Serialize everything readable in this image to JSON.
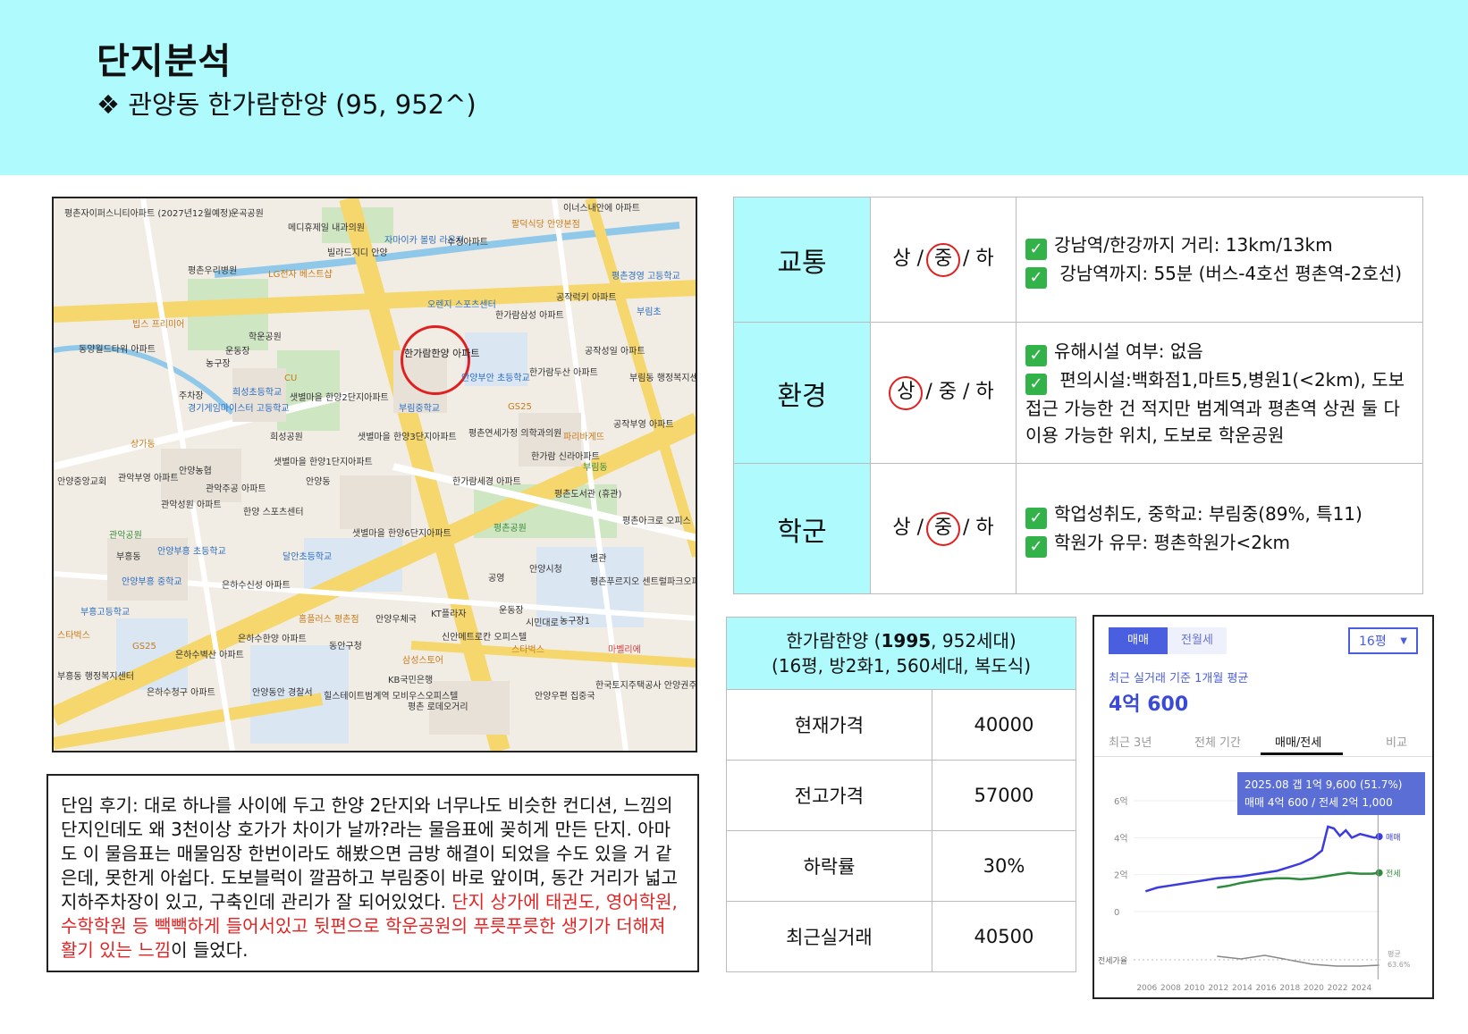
{
  "header": {
    "title": "단지분석",
    "subtitle": "❖ 관양동 한가람한양 (95, 952^)"
  },
  "map": {
    "labels": [
      "평촌자이퍼스니티아파트 (2027년12월예정)",
      "운곡공원",
      "메디휴제일 내과의원",
      "자마이카 볼링 라운지",
      "빌라드지디 안양",
      "수정아파트",
      "이너스내안에 아파트",
      "팔덕식당 안양본점",
      "평촌우리병원",
      "LG전자 베스트샵",
      "평촌경영 고등학교",
      "공작럭키 아파트",
      "오렌지 스포츠센터",
      "한가람삼성 아파트",
      "부림초",
      "빕스 프리미어",
      "학운공원",
      "동양월드타워 아파트",
      "운동장",
      "한가람한양 아파트",
      "공작성일 아파트",
      "농구장",
      "안양부안 초등학교",
      "한가람두산 아파트",
      "부림동 행정복지센터",
      "희성초등학교",
      "샛별마을 한양2단지아파트",
      "CU",
      "주차장",
      "경기게임마이스터 고등학교",
      "부림중학교",
      "GS25",
      "평촌연세가정 의학과의원",
      "공작부영 아파트",
      "희성공원",
      "샛별마을 한양3단지아파트",
      "파리바게뜨",
      "상가동",
      "안양농협",
      "샛별마을 한양1단지아파트",
      "한가람 신라아파트",
      "부림동",
      "안양중앙교회",
      "관악부영 아파트",
      "관악주공 아파트",
      "안양동",
      "한가람세경 아파트",
      "평촌도서관 (휴관)",
      "관악성원 아파트",
      "한양 스포츠센터",
      "샛별마을 한양6단지아파트",
      "평촌공원",
      "평촌아크로 오피스",
      "관악공원",
      "부흥동",
      "안양부흥 초등학교",
      "달안초등학교",
      "안양시청",
      "별관",
      "공영",
      "안양부흥 중학교",
      "은하수신성 아파트",
      "평촌푸르지오 센트럴파크오피스텔",
      "부흥고등학교",
      "홈플러스 평촌점",
      "KT플라자",
      "운동장",
      "시민대로",
      "농구장1",
      "스타벅스",
      "은하수한양 아파트",
      "안양우체국",
      "신안메트로칸 오피스텔",
      "마벨리에",
      "은하수벽산 아파트",
      "동안구청",
      "스타벅스",
      "삼성스토어",
      "부흥동 행정복지센터",
      "은하수청구 아파트",
      "안양동안 경찰서",
      "KB국민은행",
      "힐스테이트범계역 모비우스오피스텔",
      "평촌 로데오거리",
      "안양우편 집중국",
      "한국토지주택공사 안양권주거복지지사",
      "GS25"
    ]
  },
  "analysis": {
    "rows": [
      {
        "category": "교통",
        "grade_parts": [
          "상 / ",
          "중",
          " / 하"
        ],
        "circled": "중",
        "items": [
          "강남역/한강까지 거리: 13km/13km",
          " 강남역까지:  55분 (버스-4호선  평촌역-2호선)"
        ]
      },
      {
        "category": "환경",
        "grade_parts": [
          "",
          "상",
          " / 중 / 하"
        ],
        "circled": "상",
        "items": [
          "유해시설 여부: 없음",
          "  편의시설:백화점1,마트5,병원1(<2km),  도보 접근 가능한 건 적지만 범계역과 평촌역 상권 둘 다 이용 가능한 위치, 도보로 학운공원"
        ]
      },
      {
        "category": "학군",
        "grade_parts": [
          "상 / ",
          "중",
          " / 하"
        ],
        "circled": "중",
        "items": [
          "학업성취도, 중학교: 부림중(89%, 특11)",
          "학원가 유무: 평촌학원가<2km"
        ]
      }
    ],
    "check_icon": "✓"
  },
  "review": {
    "plain": "단임 후기: 대로 하나를 사이에 두고 한양 2단지와 너무나도 비슷한 컨디션, 느낌의 단지인데도 왜 3천이상 호가가 차이가 날까?라는 물음표에 꽂히게 만든 단지. 아마도 이 물음표는 매물임장 한번이라도 해봤으면 금방 해결이 되었을 수도 있을 거 같은데, 못한게 아쉽다. 도보블럭이 깔끔하고 부림중이 바로 앞이며, 동간 거리가 넓고 지하주차장이 있고, 구축인데 관리가 잘 되어있었다. ",
    "highlight": "단지 상가에 태권도, 영어학원, 수학학원 등 빽빽하게 들어서있고 뒷편으로 학운공원의 푸릇푸릇한 생기가 더해져 활기 있는 느낌",
    "tail": "이 들었다."
  },
  "price_table": {
    "header_line1_pre": "한가람한양 (",
    "header_line1_bold": "1995",
    "header_line1_post": ", 952세대)",
    "header_line2": "(16평, 방2화1, 560세대, 복도식)",
    "rows": [
      {
        "label": "현재가격",
        "value": "40000"
      },
      {
        "label": "전고가격",
        "value": "57000"
      },
      {
        "label": "하락률",
        "value": "30%"
      },
      {
        "label": "최근실거래",
        "value": "40500"
      }
    ]
  },
  "chart_panel": {
    "tab_sale": "매매",
    "tab_rent": "전월세",
    "size_select": "16평",
    "note": "최근 실거래 기준 1개월 평균",
    "price": "4억 600",
    "period_tabs": [
      "최근 3년",
      "전체 기간",
      "매매/전세",
      "비교"
    ],
    "active_tab": "매매/전세",
    "tooltip_line1": "2025.08  갭 1억 9,600 (51.7%)",
    "tooltip_line2": "매매 4억 600 / 전세 2억 1,000",
    "colors": {
      "sale": "#3b3be0",
      "rent": "#2e8b3e",
      "ratio": "#888888",
      "accent": "#4a5ee0"
    }
  },
  "chart_data": {
    "type": "line",
    "y_tick_labels": [
      "6억",
      "4억",
      "2억",
      "0"
    ],
    "ylim": [
      0,
      6
    ],
    "xlim": [
      2005,
      2025.7
    ],
    "x_tick_labels": [
      "2006",
      "2008",
      "2010",
      "2012",
      "2014",
      "2016",
      "2018",
      "2020",
      "2022",
      "2024"
    ],
    "series": [
      {
        "name": "매매",
        "x": [
          2006,
          2007,
          2008,
          2009,
          2010,
          2011,
          2012,
          2013,
          2014,
          2015,
          2016,
          2017,
          2018,
          2019,
          2020,
          2020.8,
          2021.3,
          2021.8,
          2022.3,
          2022.8,
          2023.3,
          2024,
          2024.6,
          2025.2,
          2025.6
        ],
        "values": [
          1.1,
          1.3,
          1.4,
          1.5,
          1.6,
          1.7,
          1.8,
          1.85,
          1.9,
          2.0,
          2.1,
          2.2,
          2.4,
          2.6,
          2.9,
          3.3,
          4.6,
          4.5,
          4.1,
          4.4,
          4.0,
          4.2,
          4.1,
          4.0,
          4.06
        ]
      },
      {
        "name": "전세",
        "x": [
          2012,
          2013,
          2014,
          2015,
          2016,
          2017,
          2018,
          2019,
          2020,
          2021,
          2022,
          2023,
          2024,
          2025,
          2025.6
        ],
        "values": [
          1.3,
          1.4,
          1.55,
          1.65,
          1.75,
          1.8,
          1.8,
          1.75,
          1.8,
          1.9,
          2.0,
          2.1,
          2.05,
          2.05,
          2.1
        ]
      },
      {
        "name": "전세가율",
        "x": [
          2012,
          2014,
          2016,
          2018,
          2020,
          2022,
          2024,
          2025.6
        ],
        "values": [
          0.2,
          0.05,
          0.25,
          0.0,
          -0.25,
          -0.35,
          -0.35,
          -0.3
        ]
      }
    ],
    "ratio_label": "전세가율",
    "end_labels": [
      "매매",
      "전세"
    ],
    "ratio_avg_label": "평균",
    "ratio_avg_value": "63.6%"
  }
}
